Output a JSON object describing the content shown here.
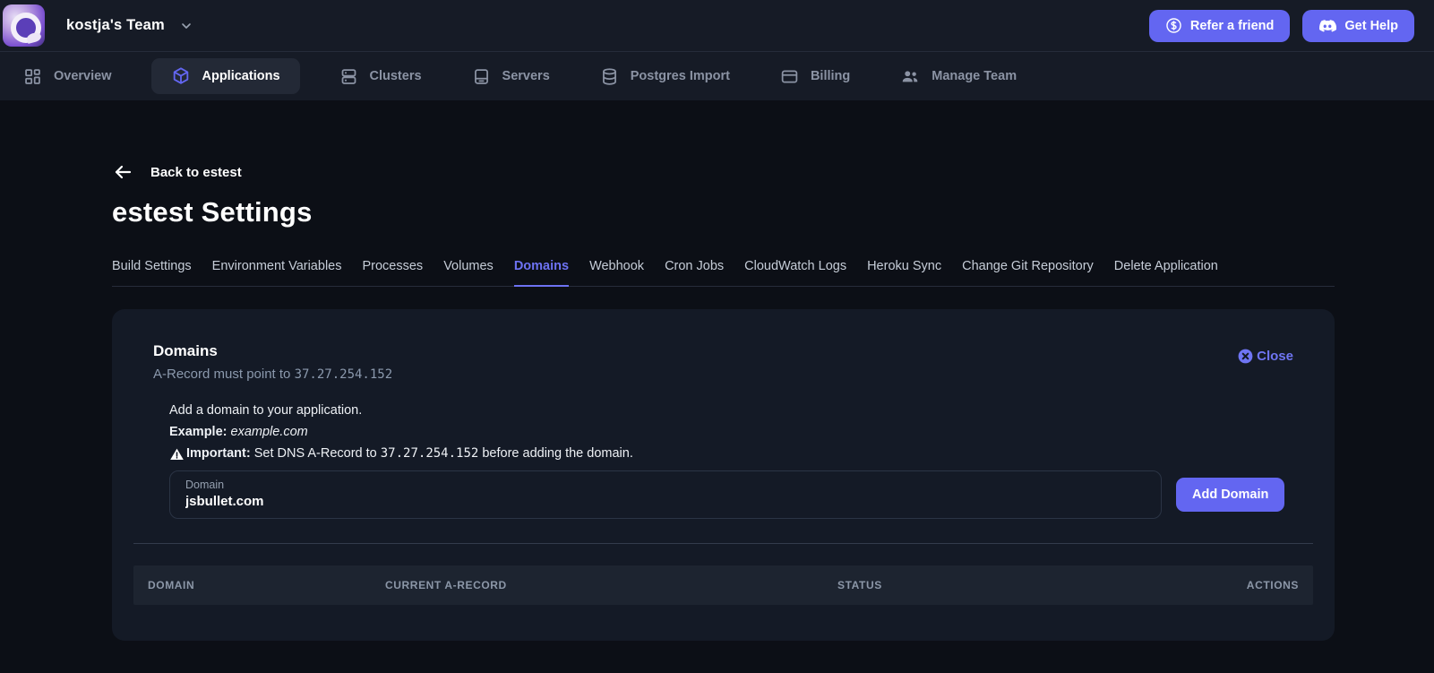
{
  "header": {
    "team_name": "kostja's Team",
    "refer_button": "Refer a friend",
    "help_button": "Get Help"
  },
  "nav": {
    "items": [
      {
        "label": "Overview",
        "icon": "grid-icon",
        "active": false
      },
      {
        "label": "Applications",
        "icon": "cube-icon",
        "active": true
      },
      {
        "label": "Clusters",
        "icon": "stack-icon",
        "active": false
      },
      {
        "label": "Servers",
        "icon": "server-icon",
        "active": false
      },
      {
        "label": "Postgres Import",
        "icon": "database-icon",
        "active": false
      },
      {
        "label": "Billing",
        "icon": "card-icon",
        "active": false
      },
      {
        "label": "Manage Team",
        "icon": "users-icon",
        "active": false
      }
    ]
  },
  "page": {
    "back_link": "Back to estest",
    "title": "estest Settings",
    "tabs": [
      {
        "label": "Build Settings",
        "active": false
      },
      {
        "label": "Environment Variables",
        "active": false
      },
      {
        "label": "Processes",
        "active": false
      },
      {
        "label": "Volumes",
        "active": false
      },
      {
        "label": "Domains",
        "active": true
      },
      {
        "label": "Webhook",
        "active": false
      },
      {
        "label": "Cron Jobs",
        "active": false
      },
      {
        "label": "CloudWatch Logs",
        "active": false
      },
      {
        "label": "Heroku Sync",
        "active": false
      },
      {
        "label": "Change Git Repository",
        "active": false
      },
      {
        "label": "Delete Application",
        "active": false
      }
    ]
  },
  "domains_card": {
    "title": "Domains",
    "subtitle_prefix": "A-Record must point to ",
    "a_record_ip": "37.27.254.152",
    "close_label": "Close",
    "instruction": "Add a domain to your application.",
    "example_label": "Example:",
    "example_value": "example.com",
    "important_label": "Important:",
    "important_before": " Set DNS A-Record to ",
    "important_after": " before adding the domain.",
    "input": {
      "label": "Domain",
      "value": "jsbullet.com"
    },
    "add_button": "Add Domain",
    "table": {
      "headers": [
        "DOMAIN",
        "CURRENT A-RECORD",
        "STATUS",
        "ACTIONS"
      ],
      "rows": []
    }
  },
  "colors": {
    "accent": "#6366f1",
    "page_bg": "#0c0f16",
    "bar_bg": "#161b26",
    "card_bg": "#141a26",
    "table_header_bg": "#1d2430"
  }
}
